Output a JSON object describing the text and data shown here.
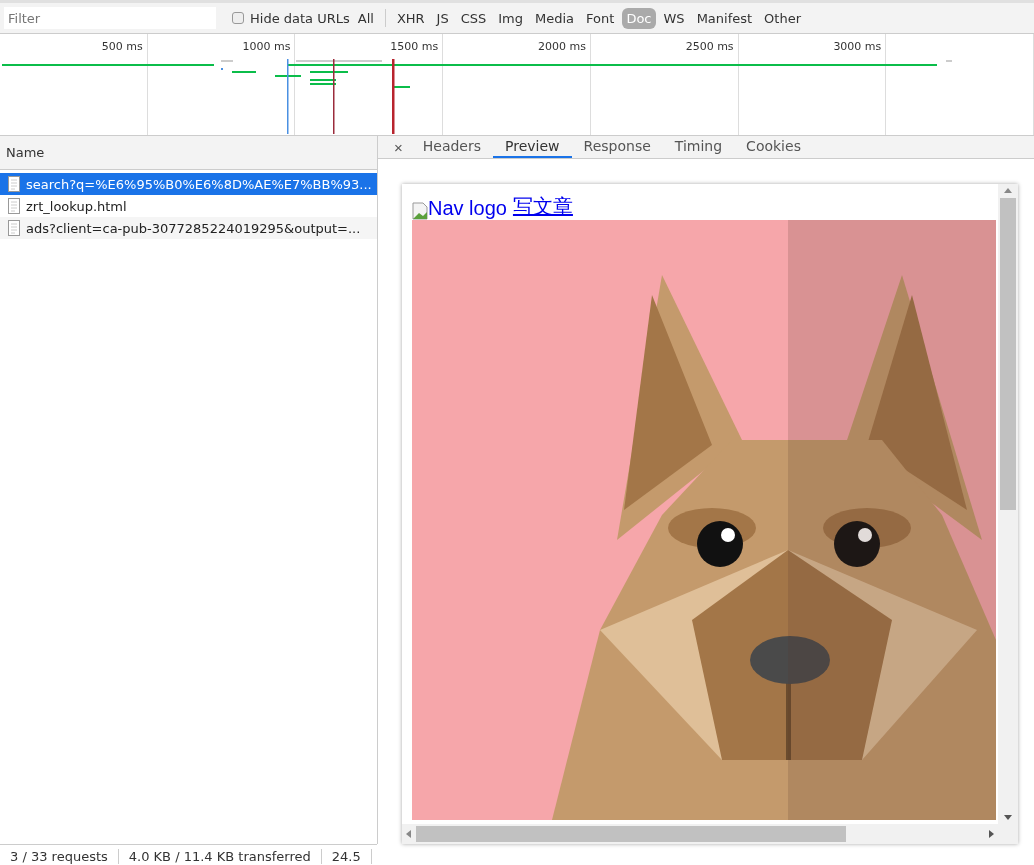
{
  "toolbar": {
    "filter": {
      "placeholder": "Filter"
    },
    "hide_data_urls": {
      "label": "Hide data URLs",
      "checked": false
    },
    "types": [
      {
        "label": "All",
        "selected": false
      },
      {
        "label": "XHR",
        "selected": false
      },
      {
        "label": "JS",
        "selected": false
      },
      {
        "label": "CSS",
        "selected": false
      },
      {
        "label": "Img",
        "selected": false
      },
      {
        "label": "Media",
        "selected": false
      },
      {
        "label": "Font",
        "selected": false
      },
      {
        "label": "Doc",
        "selected": true
      },
      {
        "label": "WS",
        "selected": false
      },
      {
        "label": "Manifest",
        "selected": false
      },
      {
        "label": "Other",
        "selected": false
      }
    ]
  },
  "timeline": {
    "ticks": [
      "500 ms",
      "1000 ms",
      "1500 ms",
      "2000 ms",
      "2500 ms",
      "3000 ms"
    ]
  },
  "requests": {
    "column": "Name",
    "rows": [
      {
        "name": "search?q=%E6%95%B0%E6%8D%AE%E7%BB%93...",
        "selected": true
      },
      {
        "name": "zrt_lookup.html",
        "selected": false
      },
      {
        "name": "ads?client=ca-pub-3077285224019295&output=...",
        "selected": false
      }
    ]
  },
  "details": {
    "close": "×",
    "tabs": [
      {
        "label": "Headers",
        "selected": false
      },
      {
        "label": "Preview",
        "selected": true
      },
      {
        "label": "Response",
        "selected": false
      },
      {
        "label": "Timing",
        "selected": false
      },
      {
        "label": "Cookies",
        "selected": false
      }
    ],
    "preview": {
      "image_alt": "Nav logo",
      "link": "写文章"
    }
  },
  "status_bar": [
    "3 / 33 requests",
    "4.0 KB / 11.4 KB transferred",
    "24.5"
  ]
}
